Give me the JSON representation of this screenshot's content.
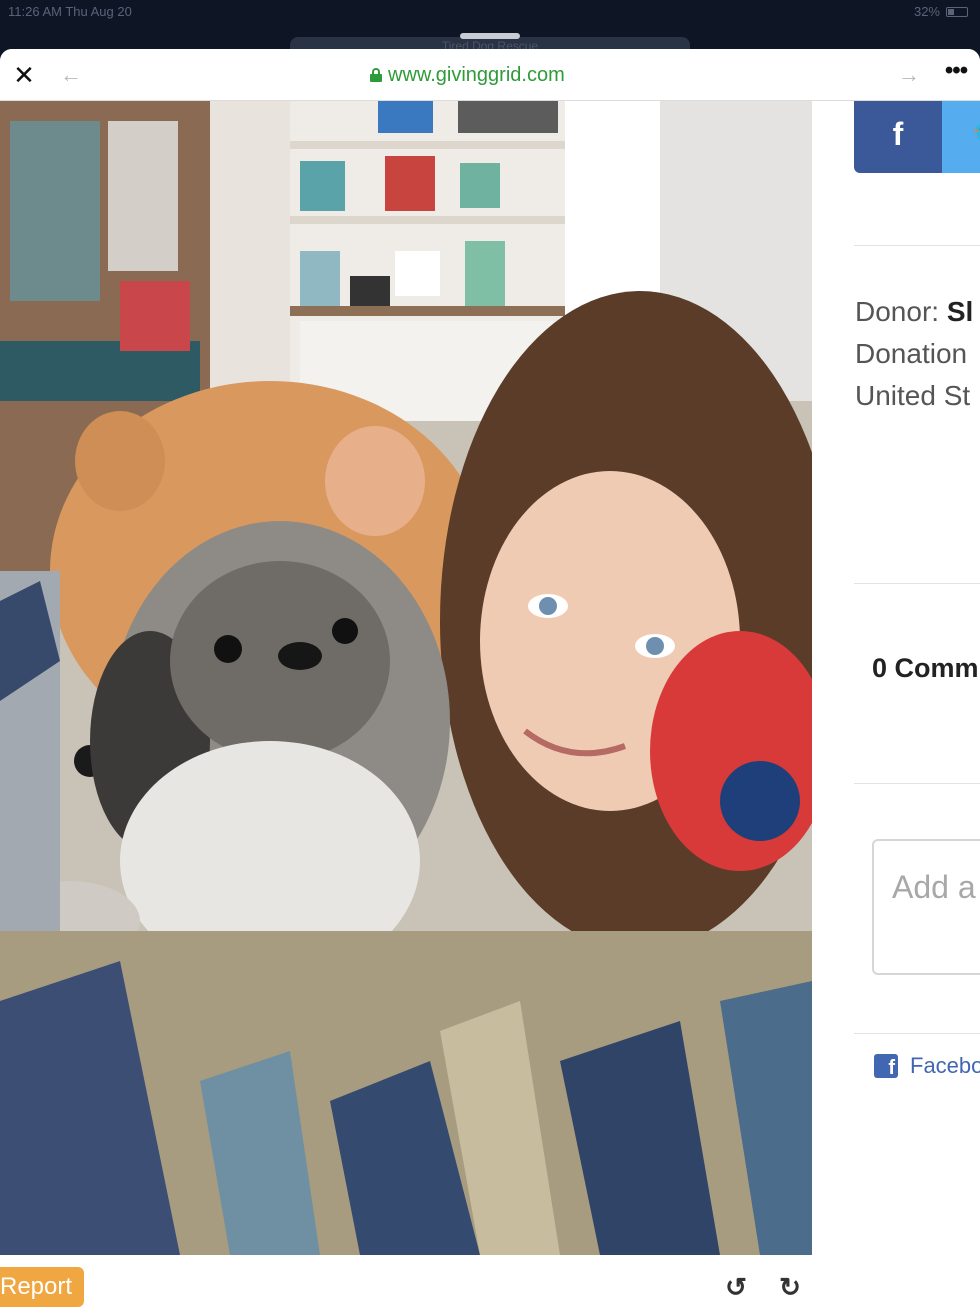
{
  "status_bar": {
    "time": "11:26 AM  Thu Aug 20",
    "battery": "32%"
  },
  "background_tab": {
    "title": "Tired Dog Rescue"
  },
  "browser": {
    "url": "www.givinggrid.com",
    "close_icon": "close-icon",
    "back_icon": "arrow-left-icon",
    "forward_icon": "arrow-right-icon",
    "more_icon": "more-icon"
  },
  "photo": {
    "description_icon": "photo"
  },
  "sidebar": {
    "share_facebook": "f",
    "share_twitter": "t",
    "donor_label": "Donor:",
    "donor_name": "Sl",
    "donation_text": "Donation",
    "country_text": "United St",
    "comments_count": "0 Comm",
    "comment_placeholder": "Add a",
    "facebook_plugin": "Facebo"
  },
  "bottom": {
    "report_label": "Report"
  },
  "colors": {
    "url_green": "#2e9b3a",
    "facebook": "#3b5998",
    "twitter": "#55acee",
    "report": "#f0a742"
  }
}
